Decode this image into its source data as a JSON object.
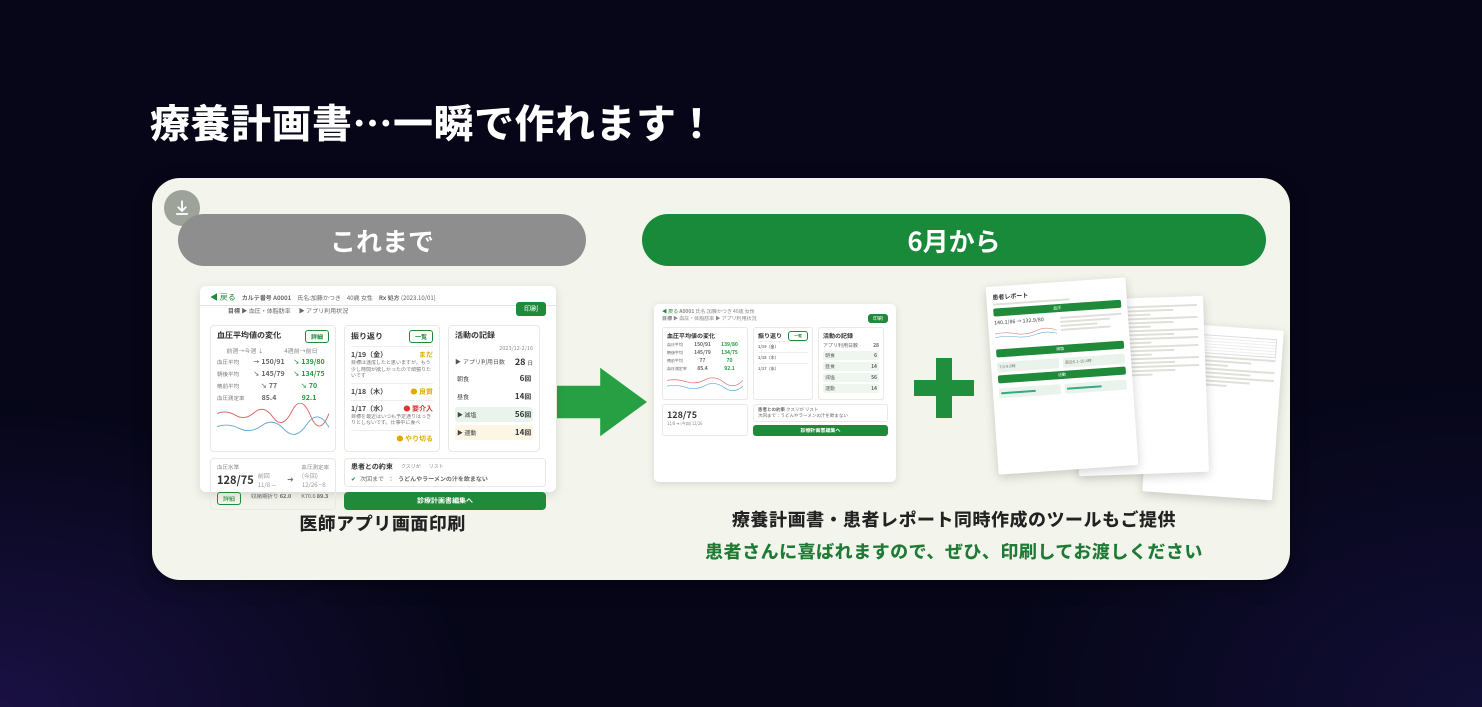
{
  "title": "療養計画書…一瞬で作れます！",
  "panel": {
    "download_icon": "download-icon",
    "pill_before": "これまで",
    "pill_after": "6月から",
    "caption_left": "医師アプリ画面印刷",
    "caption_right_line1": "療養計画書・患者レポート同時作成のツールもご提供",
    "caption_right_line2": "患者さんに喜ばれますので、ぜひ、印刷してお渡しください"
  },
  "app": {
    "back_label": "戻る",
    "header": {
      "karte_id_label": "カルテ番号",
      "karte_id": "A0001",
      "name_label": "氏名",
      "name": "加藤かつき",
      "age_sex": "40歳 女性",
      "rx_label": "Rx 処方",
      "rx_date": "(2023.10/01)"
    },
    "subhead": {
      "goal_label": "目標",
      "goal_value": "血圧・体脂肪率",
      "app_usage_label": "アプリ利用状況"
    },
    "print_btn": "印刷",
    "bp": {
      "title": "血圧平均値の変化",
      "detail_btn": "詳細",
      "col_prev": "前週→今週 ↓",
      "col_4w": "4週前→前日",
      "rows": [
        {
          "label": "血圧平均",
          "prev": "150/91",
          "now": "139/80",
          "green": true
        },
        {
          "label": "朝後平均",
          "prev": "145/79",
          "now": "134/75",
          "green": true
        },
        {
          "label": "晩前平均",
          "prev": "77",
          "now": "70",
          "green": true
        },
        {
          "label": "血圧測定率",
          "prev": "85.4",
          "now": "92.1",
          "green": true
        }
      ]
    },
    "vk": {
      "title": "振り返り",
      "list_btn": "一覧",
      "entries": [
        {
          "date": "1/19（金）",
          "status": "まだ",
          "text": "目標は達成したと思いますが，もう少し時間が欲しかったので頑張りたいです"
        },
        {
          "date": "1/18（木）",
          "status": "良質",
          "text": "",
          "dot": "y"
        },
        {
          "date": "1/17（水）",
          "status": "要介入",
          "text": "目標を最近はいつも予定通りはっきりとしないです。仕事中に食べ",
          "dot": "r"
        },
        {
          "date": "",
          "status": "やり切る",
          "text": "",
          "dot": "y"
        }
      ]
    },
    "activity": {
      "title": "活動の記録",
      "date_range": "2023/12-2/16",
      "main_label": "アプリ利用日数",
      "main_value": "28",
      "main_unit": "日",
      "subs": [
        {
          "label": "朝食",
          "value": "6",
          "unit": "回",
          "cls": ""
        },
        {
          "label": "昼食",
          "value": "14",
          "unit": "回",
          "cls": ""
        },
        {
          "label": "減塩",
          "value": "56",
          "unit": "回",
          "cls": "green"
        },
        {
          "label": "運動",
          "value": "14",
          "unit": "回",
          "cls": "yellow"
        }
      ]
    },
    "bsummary": {
      "header_left": "血圧水準",
      "header_right": "血圧測定率",
      "big": "128/75",
      "prev_date_label": "前回",
      "prev_date": "11/8",
      "change": "—",
      "now_date": "(今回) 12/26",
      "now_change": "−8",
      "mini_label1": "収縮期折り",
      "mini_val1": "62.0",
      "mini_label2": "K70.6",
      "mini_val2": "89.3",
      "outline_btn": "詳細"
    },
    "promise": {
      "title": "患者との約束",
      "tag1": "クスリが",
      "tag2": "リスト",
      "check_label": "次回まで",
      "promise_text": "うどんやラーメンの汁を飲まない",
      "cta": "診療計画書編集へ"
    }
  },
  "report": {
    "title": "患者レポート",
    "bp_line": "140.1/86 → 132.9/80",
    "section_bp": "血圧",
    "section_salt": "減塩",
    "section_act": "活動",
    "period_prev": "7.0-9.8時",
    "period_now": "直近8.1-10.4時"
  },
  "plan_form": {
    "label": "療養計画書"
  }
}
